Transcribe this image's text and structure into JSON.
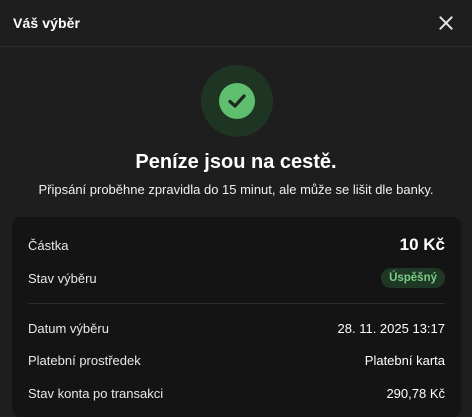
{
  "header": {
    "title": "Váš výběr"
  },
  "status": {
    "headline": "Peníze jsou na cestě.",
    "subline": "Připsání proběhne zpravidla do 15 minut, ale může se lišit dle banky."
  },
  "details": {
    "amount_label": "Částka",
    "amount_value": "10 Kč",
    "status_label": "Stav výběru",
    "status_value": "Úspěšný",
    "date_label": "Datum výběru",
    "date_value": "28. 11. 2025 13:17",
    "method_label": "Platební prostředek",
    "method_value": "Platební karta",
    "balance_label": "Stav konta po transakci",
    "balance_value": "290,78 Kč"
  },
  "colors": {
    "accent_green": "#5fbf6e",
    "badge_text": "#79cc86",
    "background": "#1e1e1e",
    "card": "#141414"
  },
  "icons": {
    "close": "close-icon",
    "success": "checkmark-icon"
  }
}
